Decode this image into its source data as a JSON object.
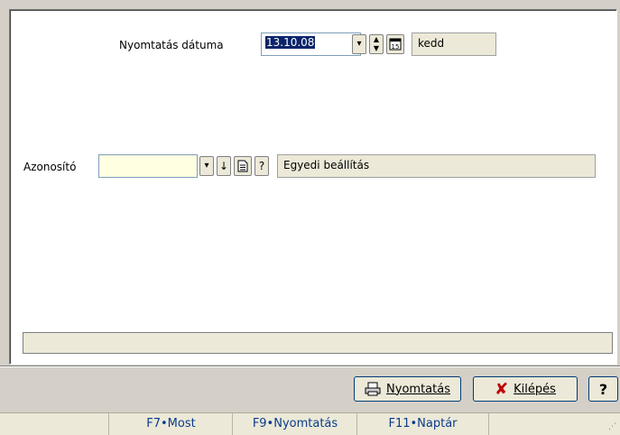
{
  "form": {
    "date_label": "Nyomtatás dátuma",
    "date_value": "13.10.08",
    "day_name": "kedd",
    "id_label": "Azonosító",
    "id_value": "",
    "id_description": "Egyedi beállítás",
    "help_small": "?",
    "calendar_icon_text": "15"
  },
  "buttons": {
    "print_label": "Nyomtatás",
    "exit_label": "Kilépés",
    "help_label": "?"
  },
  "statusbar": {
    "items": [
      "F7•Most",
      "F9•Nyomtatás",
      "F11•Naptár"
    ]
  },
  "colors": {
    "input_yellow": "#ffffe1",
    "selection": "#0a246a",
    "exit_x": "#c00000"
  }
}
